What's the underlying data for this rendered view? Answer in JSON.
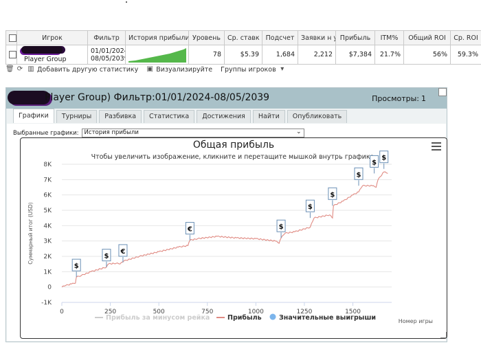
{
  "table": {
    "headers": [
      "Игрок",
      "Фильтр",
      "История прибыли",
      "Уровень",
      "Ср. ставк",
      "Подсчет",
      "Заявки н уч",
      "Прибыль",
      "ITM%",
      "Общий ROI",
      "Ср. ROI"
    ],
    "row": {
      "player": "Player Group",
      "filter_from": "01/01/2024",
      "filter_to": "08/05/2039",
      "level": "78",
      "avg_stake": "$5.39",
      "count": "1,684",
      "entries": "2,212",
      "profit": "$7,384",
      "itm": "21.7%",
      "total_roi": "56%",
      "avg_roi": "59.3%"
    }
  },
  "toolbar": {
    "add_stat": "Добавить другую статистику",
    "visualize": "Визуализируйте",
    "groups": "Группы игроков"
  },
  "panel": {
    "title": "Player Group) Фильтр:01/01/2024-08/05/2039",
    "views_label": "Просмотры:",
    "views_count": "1",
    "tabs": [
      "Графики",
      "Турниры",
      "Разбивка",
      "Статистика",
      "Достижения",
      "Найти",
      "Опубликовать"
    ],
    "select_label": "Выбранные графики:",
    "select_value": "История прибыли"
  },
  "colors": {
    "profit_line": "#c0392b",
    "profit_line_light": "#e08a82",
    "rake_line": "#cccccc",
    "marker_fill": "#7cb5ec",
    "spark_fill": "#55b84b"
  },
  "chart_data": {
    "type": "line",
    "title": "Общая прибыль",
    "subtitle": "Чтобы увеличить изображение, кликните и перетащите мышкой внутрь графика.",
    "ylabel": "Суммарный итог (USD)",
    "xlabel": "Номер игры",
    "xlim": [
      0,
      1700
    ],
    "ylim": [
      -1000,
      8000
    ],
    "x_ticks": [
      0,
      250,
      500,
      750,
      1000,
      1250,
      1500
    ],
    "y_ticks": [
      "8K",
      "7K",
      "6K",
      "5K",
      "4K",
      "3K",
      "2K",
      "1K",
      "0",
      "-1K"
    ],
    "y_tick_values": [
      8000,
      7000,
      6000,
      5000,
      4000,
      3000,
      2000,
      1000,
      0,
      -1000
    ],
    "grid": true,
    "legend_position": "bottom",
    "series": [
      {
        "name": "Прибыль за минусом рейка"
      },
      {
        "name": "Прибыль",
        "x": [
          0,
          20,
          50,
          70,
          75,
          100,
          150,
          230,
          240,
          280,
          300,
          320,
          400,
          500,
          600,
          650,
          660,
          700,
          800,
          900,
          1000,
          1100,
          1120,
          1130,
          1150,
          1200,
          1280,
          1300,
          1380,
          1395,
          1400,
          1450,
          1500,
          1530,
          1550,
          1600,
          1620,
          1630,
          1660,
          1680
        ],
        "y": [
          0,
          100,
          200,
          250,
          650,
          750,
          1000,
          1300,
          1500,
          1550,
          1500,
          1700,
          2000,
          2300,
          2600,
          2700,
          3050,
          3150,
          3300,
          3200,
          3150,
          3000,
          2850,
          3200,
          3500,
          3600,
          3900,
          4500,
          4700,
          4500,
          5300,
          5600,
          6000,
          6200,
          6600,
          6600,
          6500,
          7000,
          7500,
          7400
        ]
      }
    ],
    "markers": {
      "name": "Значительные выигрыши",
      "points": [
        {
          "x": 75,
          "y": 650,
          "label": "$"
        },
        {
          "x": 230,
          "y": 1300,
          "label": "$"
        },
        {
          "x": 315,
          "y": 1600,
          "label": "€"
        },
        {
          "x": 660,
          "y": 3050,
          "label": "€"
        },
        {
          "x": 1130,
          "y": 3200,
          "label": "$"
        },
        {
          "x": 1280,
          "y": 4500,
          "label": "$"
        },
        {
          "x": 1395,
          "y": 5300,
          "label": "$"
        },
        {
          "x": 1530,
          "y": 6600,
          "label": "$"
        },
        {
          "x": 1610,
          "y": 7400,
          "label": "$"
        },
        {
          "x": 1660,
          "y": 7700,
          "label": "$"
        }
      ]
    }
  }
}
